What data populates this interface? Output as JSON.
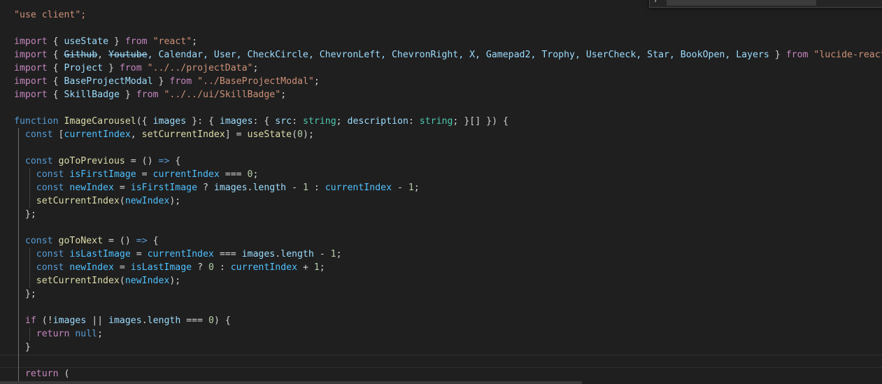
{
  "editor": {
    "lines": [
      [
        {
          "t": "\"use client\";",
          "c": "str"
        }
      ],
      [],
      [
        {
          "t": "import",
          "c": "kw"
        },
        {
          "t": " ",
          "c": "plain"
        },
        {
          "t": "{",
          "c": "b1"
        },
        {
          "t": " useState ",
          "c": "var"
        },
        {
          "t": "}",
          "c": "b1"
        },
        {
          "t": " ",
          "c": "plain"
        },
        {
          "t": "from",
          "c": "kw"
        },
        {
          "t": " ",
          "c": "plain"
        },
        {
          "t": "\"react\"",
          "c": "str"
        },
        {
          "t": ";",
          "c": "plain"
        }
      ],
      [
        {
          "t": "import",
          "c": "kw"
        },
        {
          "t": " ",
          "c": "plain"
        },
        {
          "t": "{",
          "c": "b1"
        },
        {
          "t": " ",
          "c": "plain"
        },
        {
          "t": "Github",
          "c": "strike"
        },
        {
          "t": ", ",
          "c": "plain"
        },
        {
          "t": "Youtube",
          "c": "strike"
        },
        {
          "t": ", Calendar, User, CheckCircle, ChevronLeft, ChevronRight, X, Gamepad2, Trophy, UserCheck, Star, BookOpen, Layers ",
          "c": "var"
        },
        {
          "t": "}",
          "c": "b1"
        },
        {
          "t": " ",
          "c": "plain"
        },
        {
          "t": "from",
          "c": "kw"
        },
        {
          "t": " ",
          "c": "plain"
        },
        {
          "t": "\"lucide-react\"",
          "c": "str"
        },
        {
          "t": ";",
          "c": "plain"
        }
      ],
      [
        {
          "t": "import",
          "c": "kw"
        },
        {
          "t": " ",
          "c": "plain"
        },
        {
          "t": "{",
          "c": "b1"
        },
        {
          "t": " Project ",
          "c": "var"
        },
        {
          "t": "}",
          "c": "b1"
        },
        {
          "t": " ",
          "c": "plain"
        },
        {
          "t": "from",
          "c": "kw"
        },
        {
          "t": " ",
          "c": "plain"
        },
        {
          "t": "\"../../projectData\"",
          "c": "str"
        },
        {
          "t": ";",
          "c": "plain"
        }
      ],
      [
        {
          "t": "import",
          "c": "kw"
        },
        {
          "t": " ",
          "c": "plain"
        },
        {
          "t": "{",
          "c": "b1"
        },
        {
          "t": " BaseProjectModal ",
          "c": "var"
        },
        {
          "t": "}",
          "c": "b1"
        },
        {
          "t": " ",
          "c": "plain"
        },
        {
          "t": "from",
          "c": "kw"
        },
        {
          "t": " ",
          "c": "plain"
        },
        {
          "t": "\"../BaseProjectModal\"",
          "c": "str"
        },
        {
          "t": ";",
          "c": "plain"
        }
      ],
      [
        {
          "t": "import",
          "c": "kw"
        },
        {
          "t": " ",
          "c": "plain"
        },
        {
          "t": "{",
          "c": "b1"
        },
        {
          "t": " SkillBadge ",
          "c": "var"
        },
        {
          "t": "}",
          "c": "b1"
        },
        {
          "t": " ",
          "c": "plain"
        },
        {
          "t": "from",
          "c": "kw"
        },
        {
          "t": " ",
          "c": "plain"
        },
        {
          "t": "\"../../ui/SkillBadge\"",
          "c": "str"
        },
        {
          "t": ";",
          "c": "plain"
        }
      ],
      [],
      [
        {
          "t": "function",
          "c": "decl"
        },
        {
          "t": " ",
          "c": "plain"
        },
        {
          "t": "ImageCarousel",
          "c": "fn"
        },
        {
          "t": "(",
          "c": "b1"
        },
        {
          "t": "{",
          "c": "b2"
        },
        {
          "t": " images ",
          "c": "var"
        },
        {
          "t": "}",
          "c": "b2"
        },
        {
          "t": ": ",
          "c": "plain"
        },
        {
          "t": "{",
          "c": "b2"
        },
        {
          "t": " images",
          "c": "var"
        },
        {
          "t": ": ",
          "c": "plain"
        },
        {
          "t": "{",
          "c": "b3"
        },
        {
          "t": " src",
          "c": "var"
        },
        {
          "t": ": ",
          "c": "plain"
        },
        {
          "t": "string",
          "c": "type"
        },
        {
          "t": "; ",
          "c": "plain"
        },
        {
          "t": "description",
          "c": "var"
        },
        {
          "t": ": ",
          "c": "plain"
        },
        {
          "t": "string",
          "c": "type"
        },
        {
          "t": "; ",
          "c": "plain"
        },
        {
          "t": "}",
          "c": "b3"
        },
        {
          "t": "[]",
          "c": "b3"
        },
        {
          "t": " ",
          "c": "plain"
        },
        {
          "t": "}",
          "c": "b2"
        },
        {
          "t": ")",
          "c": "b1"
        },
        {
          "t": " ",
          "c": "plain"
        },
        {
          "t": "{",
          "c": "b1m"
        }
      ],
      [
        {
          "t": "  ",
          "c": "plain"
        },
        {
          "t": "const",
          "c": "decl"
        },
        {
          "t": " ",
          "c": "plain"
        },
        {
          "t": "[",
          "c": "b2"
        },
        {
          "t": "currentIndex",
          "c": "const"
        },
        {
          "t": ", ",
          "c": "plain"
        },
        {
          "t": "setCurrentIndex",
          "c": "fn"
        },
        {
          "t": "]",
          "c": "b2"
        },
        {
          "t": " = ",
          "c": "plain"
        },
        {
          "t": "useState",
          "c": "fn"
        },
        {
          "t": "(",
          "c": "b2"
        },
        {
          "t": "0",
          "c": "num"
        },
        {
          "t": ")",
          "c": "b2"
        },
        {
          "t": ";",
          "c": "plain"
        }
      ],
      [],
      [
        {
          "t": "  ",
          "c": "plain"
        },
        {
          "t": "const",
          "c": "decl"
        },
        {
          "t": " ",
          "c": "plain"
        },
        {
          "t": "goToPrevious",
          "c": "fn"
        },
        {
          "t": " = ",
          "c": "plain"
        },
        {
          "t": "()",
          "c": "b2"
        },
        {
          "t": " ",
          "c": "plain"
        },
        {
          "t": "=>",
          "c": "decl"
        },
        {
          "t": " ",
          "c": "plain"
        },
        {
          "t": "{",
          "c": "b2"
        }
      ],
      [
        {
          "t": "    ",
          "c": "plain"
        },
        {
          "t": "const",
          "c": "decl"
        },
        {
          "t": " ",
          "c": "plain"
        },
        {
          "t": "isFirstImage",
          "c": "const"
        },
        {
          "t": " = ",
          "c": "plain"
        },
        {
          "t": "currentIndex",
          "c": "const"
        },
        {
          "t": " === ",
          "c": "plain"
        },
        {
          "t": "0",
          "c": "num"
        },
        {
          "t": ";",
          "c": "plain"
        }
      ],
      [
        {
          "t": "    ",
          "c": "plain"
        },
        {
          "t": "const",
          "c": "decl"
        },
        {
          "t": " ",
          "c": "plain"
        },
        {
          "t": "newIndex",
          "c": "const"
        },
        {
          "t": " = ",
          "c": "plain"
        },
        {
          "t": "isFirstImage",
          "c": "const"
        },
        {
          "t": " ? ",
          "c": "plain"
        },
        {
          "t": "images",
          "c": "var"
        },
        {
          "t": ".",
          "c": "plain"
        },
        {
          "t": "length",
          "c": "var"
        },
        {
          "t": " - ",
          "c": "plain"
        },
        {
          "t": "1",
          "c": "num"
        },
        {
          "t": " : ",
          "c": "plain"
        },
        {
          "t": "currentIndex",
          "c": "const"
        },
        {
          "t": " - ",
          "c": "plain"
        },
        {
          "t": "1",
          "c": "num"
        },
        {
          "t": ";",
          "c": "plain"
        }
      ],
      [
        {
          "t": "    ",
          "c": "plain"
        },
        {
          "t": "setCurrentIndex",
          "c": "fn"
        },
        {
          "t": "(",
          "c": "b3"
        },
        {
          "t": "newIndex",
          "c": "const"
        },
        {
          "t": ")",
          "c": "b3"
        },
        {
          "t": ";",
          "c": "plain"
        }
      ],
      [
        {
          "t": "  ",
          "c": "plain"
        },
        {
          "t": "}",
          "c": "b2"
        },
        {
          "t": ";",
          "c": "plain"
        }
      ],
      [],
      [
        {
          "t": "  ",
          "c": "plain"
        },
        {
          "t": "const",
          "c": "decl"
        },
        {
          "t": " ",
          "c": "plain"
        },
        {
          "t": "goToNext",
          "c": "fn"
        },
        {
          "t": " = ",
          "c": "plain"
        },
        {
          "t": "()",
          "c": "b2"
        },
        {
          "t": " ",
          "c": "plain"
        },
        {
          "t": "=>",
          "c": "decl"
        },
        {
          "t": " ",
          "c": "plain"
        },
        {
          "t": "{",
          "c": "b2"
        }
      ],
      [
        {
          "t": "    ",
          "c": "plain"
        },
        {
          "t": "const",
          "c": "decl"
        },
        {
          "t": " ",
          "c": "plain"
        },
        {
          "t": "isLastImage",
          "c": "const"
        },
        {
          "t": " = ",
          "c": "plain"
        },
        {
          "t": "currentIndex",
          "c": "const"
        },
        {
          "t": " === ",
          "c": "plain"
        },
        {
          "t": "images",
          "c": "var"
        },
        {
          "t": ".",
          "c": "plain"
        },
        {
          "t": "length",
          "c": "var"
        },
        {
          "t": " - ",
          "c": "plain"
        },
        {
          "t": "1",
          "c": "num"
        },
        {
          "t": ";",
          "c": "plain"
        }
      ],
      [
        {
          "t": "    ",
          "c": "plain"
        },
        {
          "t": "const",
          "c": "decl"
        },
        {
          "t": " ",
          "c": "plain"
        },
        {
          "t": "newIndex",
          "c": "const"
        },
        {
          "t": " = ",
          "c": "plain"
        },
        {
          "t": "isLastImage",
          "c": "const"
        },
        {
          "t": " ? ",
          "c": "plain"
        },
        {
          "t": "0",
          "c": "num"
        },
        {
          "t": " : ",
          "c": "plain"
        },
        {
          "t": "currentIndex",
          "c": "const"
        },
        {
          "t": " + ",
          "c": "plain"
        },
        {
          "t": "1",
          "c": "num"
        },
        {
          "t": ";",
          "c": "plain"
        }
      ],
      [
        {
          "t": "    ",
          "c": "plain"
        },
        {
          "t": "setCurrentIndex",
          "c": "fn"
        },
        {
          "t": "(",
          "c": "b3"
        },
        {
          "t": "newIndex",
          "c": "const"
        },
        {
          "t": ")",
          "c": "b3"
        },
        {
          "t": ";",
          "c": "plain"
        }
      ],
      [
        {
          "t": "  ",
          "c": "plain"
        },
        {
          "t": "}",
          "c": "b2"
        },
        {
          "t": ";",
          "c": "plain"
        }
      ],
      [],
      [
        {
          "t": "  ",
          "c": "plain"
        },
        {
          "t": "if",
          "c": "kw"
        },
        {
          "t": " ",
          "c": "plain"
        },
        {
          "t": "(",
          "c": "b2"
        },
        {
          "t": "!",
          "c": "plain"
        },
        {
          "t": "images",
          "c": "var"
        },
        {
          "t": " || ",
          "c": "plain"
        },
        {
          "t": "images",
          "c": "var"
        },
        {
          "t": ".",
          "c": "plain"
        },
        {
          "t": "length",
          "c": "var"
        },
        {
          "t": " === ",
          "c": "plain"
        },
        {
          "t": "0",
          "c": "num"
        },
        {
          "t": ")",
          "c": "b2"
        },
        {
          "t": " ",
          "c": "plain"
        },
        {
          "t": "{",
          "c": "b2"
        }
      ],
      [
        {
          "t": "    ",
          "c": "plain"
        },
        {
          "t": "return",
          "c": "kw"
        },
        {
          "t": " ",
          "c": "plain"
        },
        {
          "t": "null",
          "c": "decl"
        },
        {
          "t": ";",
          "c": "plain"
        }
      ],
      [
        {
          "t": "  ",
          "c": "plain"
        },
        {
          "t": "}",
          "c": "b2"
        }
      ],
      [],
      [
        {
          "t": "  ",
          "c": "plain"
        },
        {
          "t": "return",
          "c": "kw"
        },
        {
          "t": " ",
          "c": "plain"
        },
        {
          "t": "(",
          "c": "b2"
        }
      ]
    ]
  },
  "theme": {
    "background": "#1f1f1f",
    "kw": "#c586c0",
    "decl": "#569cd6",
    "str": "#ce9178",
    "var": "#9cdcfe",
    "const": "#4fc1ff",
    "fn": "#dcdcaa",
    "type": "#4ec9b0",
    "num": "#b5cea8",
    "bracket_1": "#ffd700",
    "bracket_2": "#da70d6",
    "bracket_3": "#179fff"
  },
  "find_widget": {
    "toggle_icon": "chevron-right-icon",
    "options": [
      "match-case-icon",
      "whole-word-icon",
      "regex-icon"
    ]
  }
}
